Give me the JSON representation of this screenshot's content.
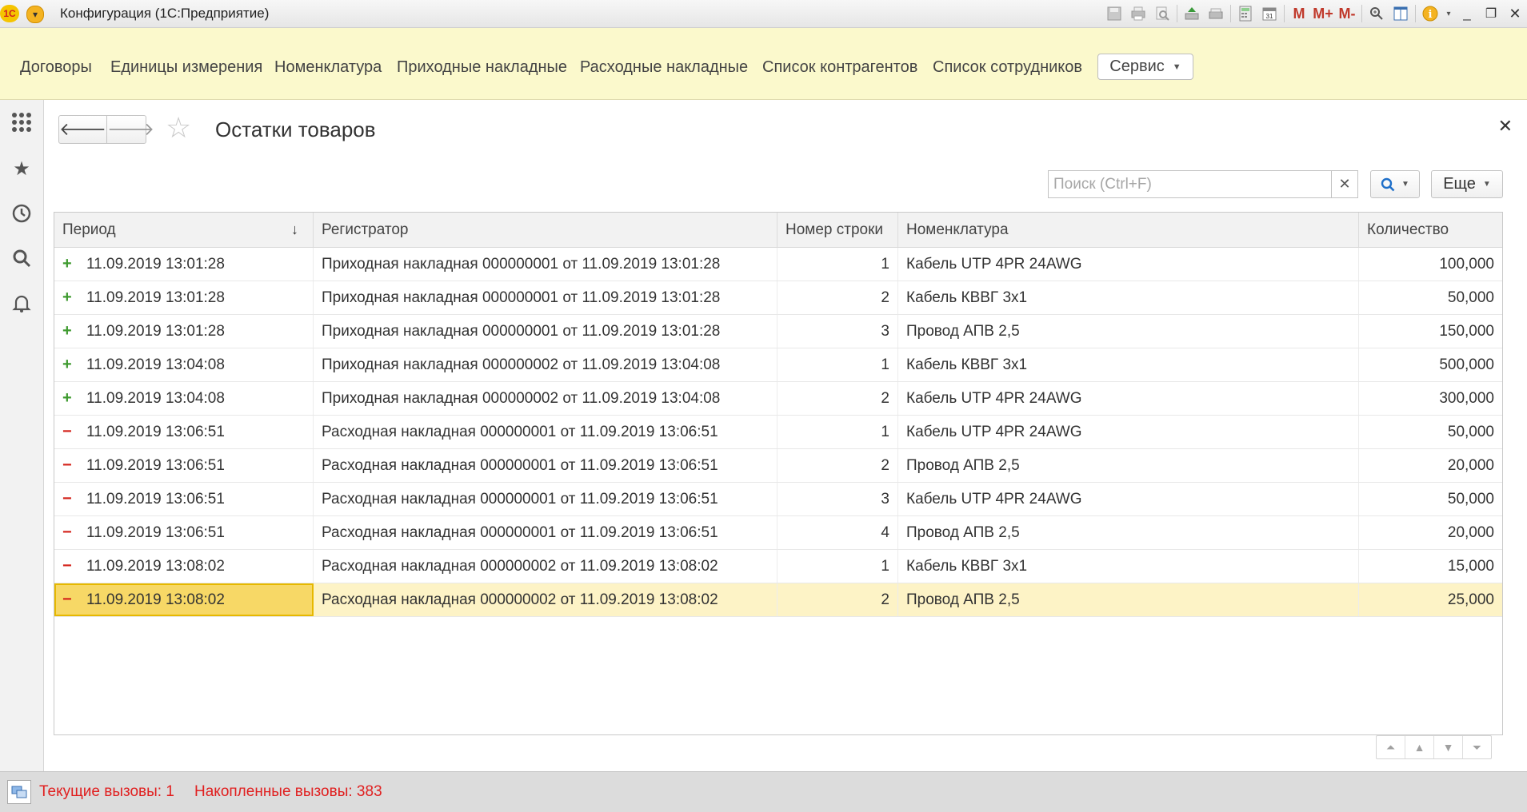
{
  "window": {
    "logo_text": "1С",
    "title": "Конфигурация  (1С:Предприятие)"
  },
  "toolbar_icons": [
    "save-icon",
    "print-icon",
    "print-preview-icon",
    "upload-icon",
    "scanner-icon",
    "calculator-icon",
    "calendar-icon",
    "m-icon",
    "m-plus-icon",
    "m-minus-icon",
    "zoom-icon",
    "panels-icon",
    "info-icon",
    "minimize-icon",
    "restore-icon",
    "close-icon"
  ],
  "sections": {
    "links": [
      "Договоры",
      "Единицы измерения",
      "Номенклатура",
      "Приходные накладные",
      "Расходные накладные",
      "Список контрагентов",
      "Список сотрудников"
    ],
    "service_label": "Сервис"
  },
  "form": {
    "title": "Остатки товаров",
    "search_placeholder": "Поиск (Ctrl+F)",
    "more_label": "Еще"
  },
  "table": {
    "columns": [
      "Период",
      "Регистратор",
      "Номер строки",
      "Номенклатура",
      "Количество"
    ],
    "rows": [
      {
        "type": "plus",
        "period": "11.09.2019 13:01:28",
        "registrar": "Приходная накладная 000000001 от 11.09.2019 13:01:28",
        "line": "1",
        "item": "Кабель UTP 4PR 24AWG",
        "qty": "100,000"
      },
      {
        "type": "plus",
        "period": "11.09.2019 13:01:28",
        "registrar": "Приходная накладная 000000001 от 11.09.2019 13:01:28",
        "line": "2",
        "item": "Кабель КВВГ 3х1",
        "qty": "50,000"
      },
      {
        "type": "plus",
        "period": "11.09.2019 13:01:28",
        "registrar": "Приходная накладная 000000001 от 11.09.2019 13:01:28",
        "line": "3",
        "item": "Провод АПВ 2,5",
        "qty": "150,000"
      },
      {
        "type": "plus",
        "period": "11.09.2019 13:04:08",
        "registrar": "Приходная накладная 000000002 от 11.09.2019 13:04:08",
        "line": "1",
        "item": "Кабель КВВГ 3х1",
        "qty": "500,000"
      },
      {
        "type": "plus",
        "period": "11.09.2019 13:04:08",
        "registrar": "Приходная накладная 000000002 от 11.09.2019 13:04:08",
        "line": "2",
        "item": "Кабель UTP 4PR 24AWG",
        "qty": "300,000"
      },
      {
        "type": "minus",
        "period": "11.09.2019 13:06:51",
        "registrar": "Расходная накладная 000000001 от 11.09.2019 13:06:51",
        "line": "1",
        "item": "Кабель UTP 4PR 24AWG",
        "qty": "50,000"
      },
      {
        "type": "minus",
        "period": "11.09.2019 13:06:51",
        "registrar": "Расходная накладная 000000001 от 11.09.2019 13:06:51",
        "line": "2",
        "item": "Провод АПВ 2,5",
        "qty": "20,000"
      },
      {
        "type": "minus",
        "period": "11.09.2019 13:06:51",
        "registrar": "Расходная накладная 000000001 от 11.09.2019 13:06:51",
        "line": "3",
        "item": "Кабель UTP 4PR 24AWG",
        "qty": "50,000"
      },
      {
        "type": "minus",
        "period": "11.09.2019 13:06:51",
        "registrar": "Расходная накладная 000000001 от 11.09.2019 13:06:51",
        "line": "4",
        "item": "Провод АПВ 2,5",
        "qty": "20,000"
      },
      {
        "type": "minus",
        "period": "11.09.2019 13:08:02",
        "registrar": "Расходная накладная 000000002 от 11.09.2019 13:08:02",
        "line": "1",
        "item": "Кабель КВВГ 3х1",
        "qty": "15,000"
      },
      {
        "type": "minus",
        "period": "11.09.2019 13:08:02",
        "registrar": "Расходная накладная 000000002 от 11.09.2019 13:08:02",
        "line": "2",
        "item": "Провод АПВ 2,5",
        "qty": "25,000",
        "selected": true
      }
    ]
  },
  "status": {
    "current_calls": "Текущие вызовы: 1",
    "accumulated_calls": "Накопленные вызовы: 383"
  },
  "colors": {
    "sections_bg": "#fbf9cc",
    "plus": "#3e9a2f",
    "minus": "#d4241c",
    "selected_row": "#fdf3c6",
    "status_text": "#e02020"
  }
}
